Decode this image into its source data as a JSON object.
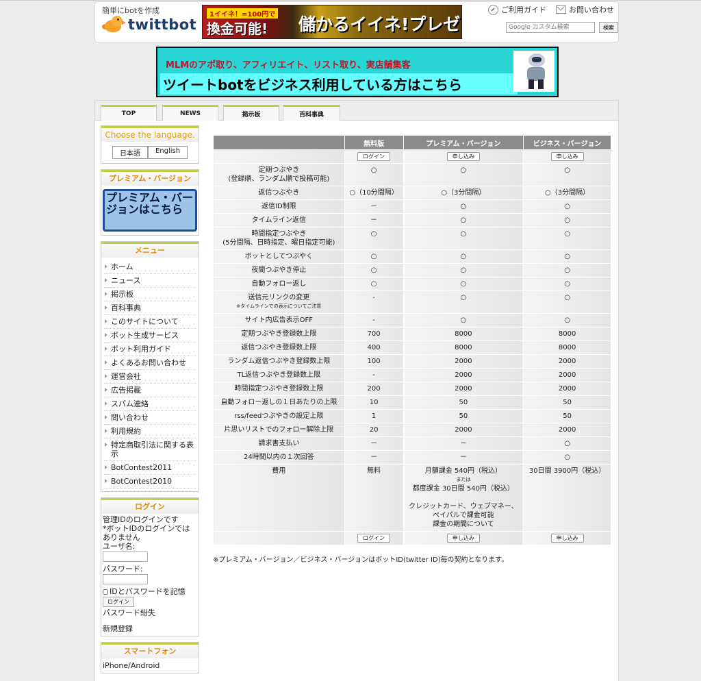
{
  "header": {
    "tagline": "簡単にbotを作成",
    "logo_text": "twittbot",
    "banner_top": {
      "line1": "1イイネ！=100円で",
      "line2": "換金可能!",
      "line3": "儲かるイイネ!プレゼント"
    },
    "links": {
      "guide": "ご利用ガイド",
      "contact": "お問い合わせ"
    },
    "search": {
      "placeholder": "Google カスタム検索",
      "button": "検索"
    }
  },
  "banner_mid": {
    "line1": "MLMのアポ取り、アフィリエイト、リスト取り、実店舗集客",
    "line2": "ツイートbotをビジネス利用している方はこちら"
  },
  "tabs": [
    "TOP",
    "NEWS",
    "掲示板",
    "百科事典"
  ],
  "sidebar": {
    "language": {
      "title": "Choose the language.",
      "ja": "日本語",
      "en": "English"
    },
    "premium": {
      "title": "プレミアム・バージョン",
      "button": "プレミアム・バージョンはこちら"
    },
    "menu": {
      "title": "メニュー",
      "items": [
        "ホーム",
        "ニュース",
        "掲示板",
        "百科事典",
        "このサイトについて",
        "ボット生成サービス",
        "ボット利用ガイド",
        "よくあるお問い合わせ",
        "運営会社",
        "広告掲載",
        "スパム連絡",
        "問い合わせ",
        "利用規約",
        "特定商取引法に関する表示",
        "BotContest2011",
        "BotContest2010"
      ]
    },
    "login": {
      "title": "ログイン",
      "note1": "管理IDのログインです",
      "note2": "*ボットIDのログインではありません",
      "user_label": "ユーザ名:",
      "pass_label": "パスワード:",
      "remember": "IDとパスワードを記憶",
      "button": "ログイン",
      "forgot": "パスワード紛失",
      "register": "新規登録"
    },
    "smartphone": {
      "title": "スマートフォン",
      "item": "iPhone/Android"
    }
  },
  "table": {
    "headers": [
      "",
      "無料版",
      "プレミアム・バージョン",
      "ビジネス・バージョン"
    ],
    "buttons_top": [
      "ログイン",
      "申し込み",
      "申し込み"
    ],
    "rows": [
      {
        "label": "定期つぶやき\n(登録順、ランダム順で投稿可能)",
        "v": [
          "○",
          "○",
          "○"
        ]
      },
      {
        "label": "返信つぶやき",
        "v": [
          "○（10分間隔）",
          "○（3分間隔）",
          "○（3分間隔）"
        ]
      },
      {
        "label": "返信ID制限",
        "v": [
          "－",
          "○",
          "○"
        ]
      },
      {
        "label": "タイムライン返信",
        "v": [
          "－",
          "○",
          "○"
        ]
      },
      {
        "label": "時間指定つぶやき\n(5分間隔、日時指定、曜日指定可能)",
        "v": [
          "○",
          "○",
          "○"
        ]
      },
      {
        "label": "ボットとしてつぶやく",
        "v": [
          "○",
          "○",
          "○"
        ]
      },
      {
        "label": "夜間つぶやき停止",
        "v": [
          "○",
          "○",
          "○"
        ]
      },
      {
        "label": "自動フォロー返し",
        "v": [
          "○",
          "○",
          "○"
        ]
      },
      {
        "label": "送信元リンクの変更",
        "sub": "※タイムラインでの表示についてご注意",
        "v": [
          "-",
          "○",
          "○"
        ]
      },
      {
        "label": "サイト内広告表示OFF",
        "v": [
          "-",
          "○",
          "○"
        ]
      },
      {
        "label": "定期つぶやき登録数上限",
        "v": [
          "700",
          "8000",
          "8000"
        ]
      },
      {
        "label": "返信つぶやき登録数上限",
        "v": [
          "400",
          "8000",
          "8000"
        ]
      },
      {
        "label": "ランダム返信つぶやき登録数上限",
        "v": [
          "100",
          "2000",
          "2000"
        ]
      },
      {
        "label": "TL返信つぶやき登録数上限",
        "v": [
          "-",
          "2000",
          "2000"
        ]
      },
      {
        "label": "時間指定つぶやき登録数上限",
        "v": [
          "200",
          "2000",
          "2000"
        ]
      },
      {
        "label": "自動フォロー返しの１日あたりの上限",
        "v": [
          "10",
          "50",
          "50"
        ]
      },
      {
        "label": "rss/feedつぶやきの設定上限",
        "v": [
          "1",
          "50",
          "50"
        ]
      },
      {
        "label": "片思いリストでのフォロー解除上限",
        "v": [
          "20",
          "2000",
          "2000"
        ]
      },
      {
        "label": "請求書支払い",
        "v": [
          "－",
          "－",
          "○"
        ]
      },
      {
        "label": "24時間以内の１次回答",
        "v": [
          "－",
          "－",
          "○"
        ]
      }
    ],
    "fee": {
      "label": "費用",
      "free": "無料",
      "premium_monthly": "月額課金 540円（税込）",
      "premium_or": "または",
      "premium_period": "都度課金 30日間 540円（税込）",
      "premium_methods": "クレジットカード、ウェブマネー、ペイパルで課金可能",
      "premium_period_link": "課金の期間について",
      "business": "30日間 3900円（税込）"
    },
    "buttons_bottom": [
      "ログイン",
      "申し込み",
      "申し込み"
    ]
  },
  "footnote": "※プレミアム・バージョン／ビジネス・バージョンはボットID(twitter ID)毎の契約となります。"
}
